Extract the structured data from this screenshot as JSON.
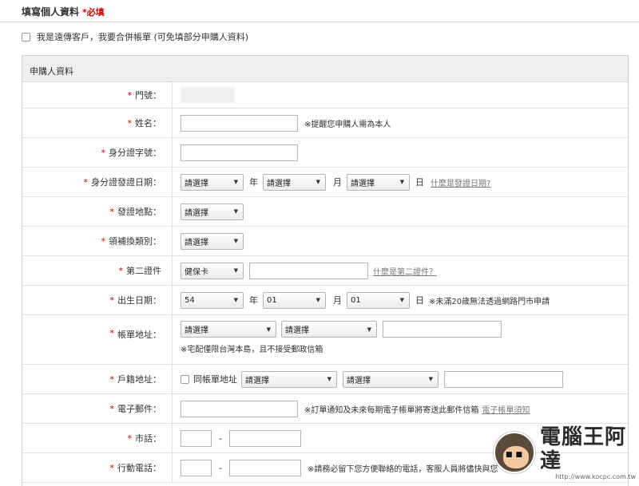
{
  "header": {
    "title": "填寫個人資料",
    "required_note": "*必填"
  },
  "merge": {
    "label": "我是遠傳客戶，我要合併帳單 (可免填部分申購人資料)"
  },
  "section": {
    "title": "申購人資料"
  },
  "fields": {
    "door": {
      "label": "門號："
    },
    "name": {
      "label": "姓名：",
      "note": "※提醒您申購人需為本人"
    },
    "id_number": {
      "label": "身分證字號："
    },
    "id_issue_date": {
      "label": "身分證發證日期：",
      "year_select": "請選擇",
      "year_unit": "年",
      "month_select": "請選擇",
      "month_unit": "月",
      "day_select": "請選擇",
      "day_unit": "日",
      "help_link": "什麼是發證日期?"
    },
    "issue_place": {
      "label": "發證地點：",
      "select": "請選擇"
    },
    "reissue_type": {
      "label": "領補換類別：",
      "select": "請選擇"
    },
    "second_id": {
      "label": "第二證件",
      "select": "健保卡",
      "help_link": "什麼是第二證件？"
    },
    "birth_date": {
      "label": "出生日期：",
      "year_value": "54",
      "year_unit": "年",
      "month_value": "01",
      "month_unit": "月",
      "day_value": "01",
      "day_unit": "日",
      "note": "※未滿20歲無法透過網路門市申請"
    },
    "billing_address": {
      "label": "帳單地址：",
      "city_select": "請選擇",
      "district_select": "請選擇",
      "note": "※宅配僅限台灣本島，且不接受郵政信箱"
    },
    "household_address": {
      "label": "戶籍地址：",
      "same_label": "同帳單地址",
      "city_select": "請選擇",
      "district_select": "請選擇"
    },
    "email": {
      "label": "電子郵件：",
      "note": "※訂單通知及未來每期電子帳單將寄送此郵件信箱",
      "help_link": "電子帳單須知"
    },
    "phone": {
      "label": "市話：",
      "dash": "-"
    },
    "mobile": {
      "label": "行動電話：",
      "dash": "-",
      "note": "※請務必留下您方便聯絡的電話，客服人員將儘快與您"
    }
  },
  "required_star": "*",
  "watermark": {
    "name": "電腦王阿達",
    "url": "http://www.kocpc.com.tw"
  }
}
